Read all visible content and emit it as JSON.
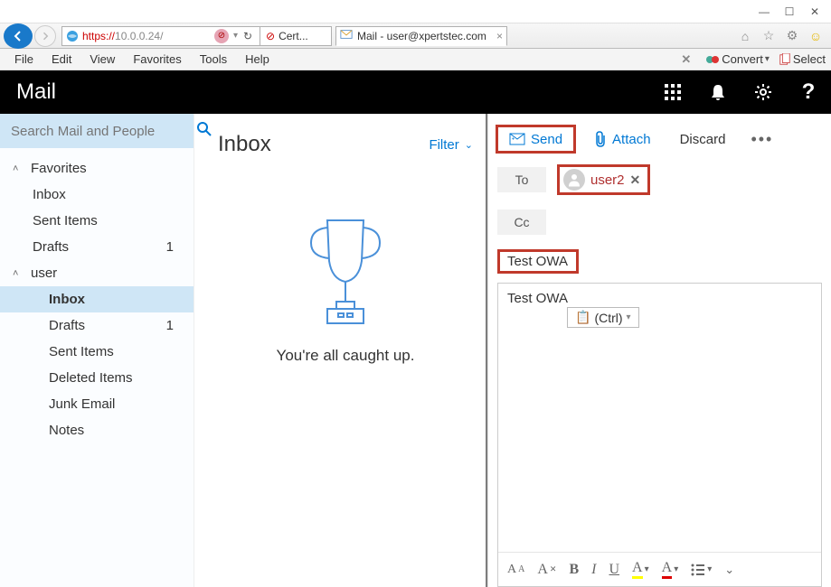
{
  "window": {
    "minimize": "–",
    "maximize": "☐",
    "close": "✕"
  },
  "addressbar": {
    "scheme": "https://",
    "rest": "10.0.0.24/"
  },
  "tabs": {
    "cert": "Cert...",
    "mail": "Mail - user@xpertstec.com"
  },
  "menubar": {
    "items": [
      "File",
      "Edit",
      "View",
      "Favorites",
      "Tools",
      "Help"
    ],
    "convert": "Convert",
    "select": "Select"
  },
  "owa": {
    "brand": "Mail"
  },
  "search": {
    "placeholder": "Search Mail and People"
  },
  "sidebar": {
    "favorites": "Favorites",
    "fav_items": [
      {
        "label": "Inbox",
        "count": ""
      },
      {
        "label": "Sent Items",
        "count": ""
      },
      {
        "label": "Drafts",
        "count": "1"
      }
    ],
    "user_header": "user",
    "user_items": [
      {
        "label": "Inbox",
        "sel": true,
        "count": ""
      },
      {
        "label": "Drafts",
        "count": "1"
      },
      {
        "label": "Sent Items",
        "count": ""
      },
      {
        "label": "Deleted Items",
        "count": ""
      },
      {
        "label": "Junk Email",
        "count": ""
      },
      {
        "label": "Notes",
        "count": ""
      }
    ]
  },
  "content": {
    "title": "Inbox",
    "filter": "Filter",
    "empty": "You're all caught up."
  },
  "compose": {
    "send": "Send",
    "attach": "Attach",
    "discard": "Discard",
    "to_label": "To",
    "cc_label": "Cc",
    "recipient": "user2",
    "subject": "Test OWA",
    "body": "Test OWA",
    "paste_hint": "(Ctrl)"
  },
  "format": {
    "aa": "AA",
    "a_clear": "A",
    "b": "B",
    "i": "I",
    "u": "U",
    "a_hl": "A",
    "a_color": "A"
  }
}
